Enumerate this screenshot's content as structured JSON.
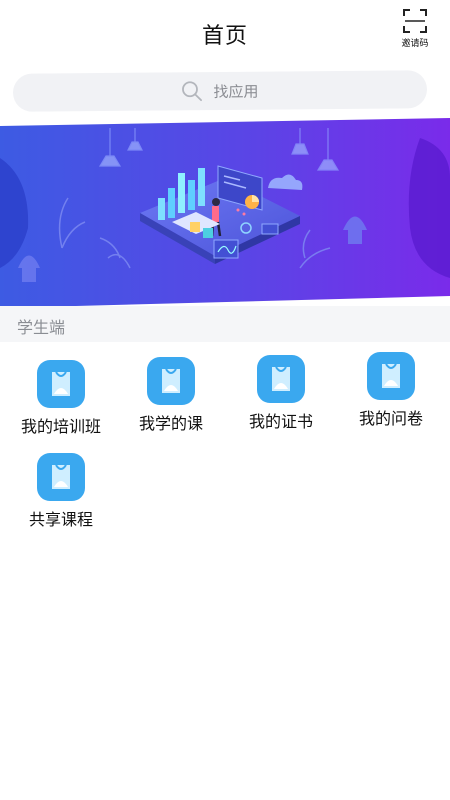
{
  "header": {
    "title": "首页",
    "invite_label": "邀请码",
    "invite_icon": "scan-frame-icon"
  },
  "search": {
    "placeholder": "找应用",
    "icon": "search-icon"
  },
  "banner": {
    "description_icon": "data-dashboard-illustration",
    "gradient_start": "#3d5be3",
    "gradient_end": "#7a2bea"
  },
  "section": {
    "title": "学生端"
  },
  "apps": [
    {
      "label": "我的培训班",
      "icon": "shopping-bag-icon"
    },
    {
      "label": "我学的课",
      "icon": "shopping-bag-icon"
    },
    {
      "label": "我的证书",
      "icon": "shopping-bag-icon"
    },
    {
      "label": "我的问卷",
      "icon": "shopping-bag-icon"
    },
    {
      "label": "共享课程",
      "icon": "shopping-bag-icon"
    }
  ],
  "colors": {
    "app_icon_bg": "#3aa8ef",
    "search_bg": "#f1f2f5",
    "section_bg": "#f5f6f8"
  }
}
